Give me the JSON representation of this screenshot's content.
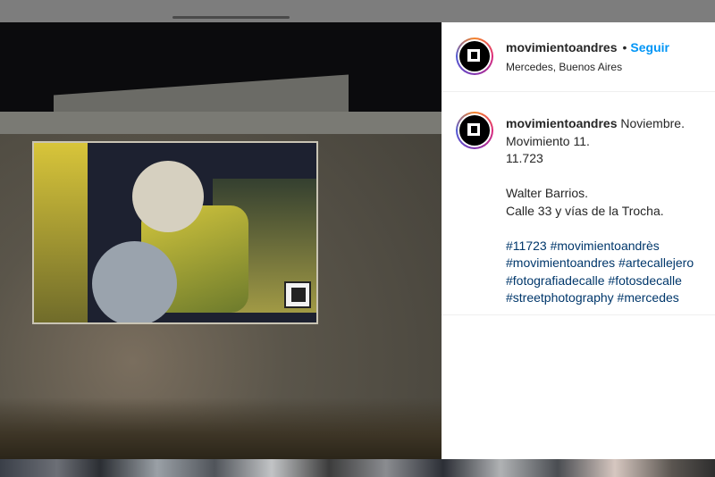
{
  "post": {
    "username": "movimientoandres",
    "follow_label": "Seguir",
    "separator": "•",
    "location": "Mercedes, Buenos Aires"
  },
  "caption": {
    "username": "movimientoandres",
    "first_line": "Noviembre.",
    "lines": [
      "Movimiento 11.",
      "11.723",
      "",
      "Walter Barrios.",
      "Calle 33 y vías de la Trocha.",
      ""
    ],
    "hashtag_lines": [
      [
        "#11723",
        "#movimientoandrès"
      ],
      [
        "#movimientoandres",
        "#artecallejero"
      ],
      [
        "#fotografiadecalle",
        "#fotosdecalle"
      ],
      [
        "#streetphotography",
        "#mercedes"
      ]
    ]
  },
  "colors": {
    "link": "#0095f6",
    "hashtag": "#00376b",
    "text": "#262626"
  },
  "icons": {
    "avatar": "movimientoandres-logo-icon"
  }
}
